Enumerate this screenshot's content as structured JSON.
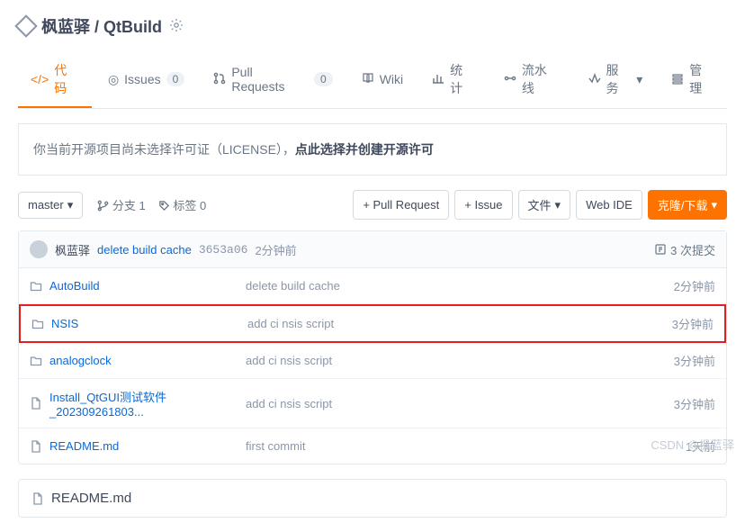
{
  "header": {
    "owner": "枫蓝驿",
    "separator": " / ",
    "repo": "QtBuild"
  },
  "tabs": [
    {
      "label": "代码",
      "active": true
    },
    {
      "label": "Issues",
      "badge": "0"
    },
    {
      "label": "Pull Requests",
      "badge": "0"
    },
    {
      "label": "Wiki"
    },
    {
      "label": "统计"
    },
    {
      "label": "流水线"
    },
    {
      "label": "服务"
    },
    {
      "label": "管理"
    }
  ],
  "notice": {
    "prefix": "你当前开源项目尚未选择许可证（LICENSE），",
    "bold": "点此选择并创建开源许可"
  },
  "toolbar": {
    "branch_label": "master",
    "branches": "分支 1",
    "tags": "标签 0",
    "pull_request": "+ Pull Request",
    "issue": "+ Issue",
    "file": "文件",
    "web_ide": "Web IDE",
    "clone": "克隆/下载"
  },
  "commit": {
    "author": "枫蓝驿",
    "message": "delete build cache",
    "sha": "3653a06",
    "time": "2分钟前",
    "count_label": "3 次提交"
  },
  "files": [
    {
      "type": "folder",
      "name": "AutoBuild",
      "msg": "delete build cache",
      "time": "2分钟前",
      "highlighted": false
    },
    {
      "type": "folder",
      "name": "NSIS",
      "msg": "add ci nsis script",
      "time": "3分钟前",
      "highlighted": true
    },
    {
      "type": "folder",
      "name": "analogclock",
      "msg": "add ci nsis script",
      "time": "3分钟前",
      "highlighted": false
    },
    {
      "type": "file",
      "name": "Install_QtGUI测试软件_202309261803...",
      "msg": "add ci nsis script",
      "time": "3分钟前",
      "highlighted": false
    },
    {
      "type": "file",
      "name": "README.md",
      "msg": "first commit",
      "time": "1天前",
      "highlighted": false
    }
  ],
  "readme": {
    "title": "README.md"
  },
  "watermark": "CSDN @枫蓝驿"
}
